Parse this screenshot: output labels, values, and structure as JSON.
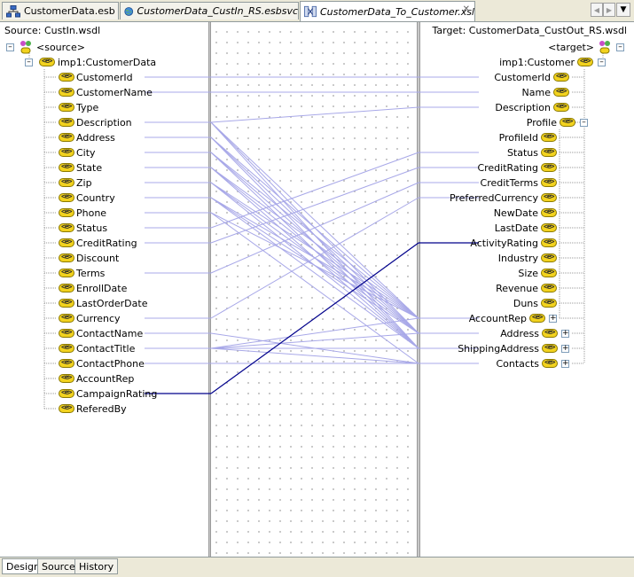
{
  "tabs": [
    {
      "label": "CustomerData.esb",
      "icon": "esb-diagram-icon",
      "italic": false
    },
    {
      "label": "CustomerData_CustIn_RS.esbsvc",
      "icon": "globe-service-icon",
      "italic": true
    },
    {
      "label": "CustomerData_To_Customer.xsl",
      "icon": "xsl-map-icon",
      "italic": true
    }
  ],
  "source": {
    "title": "Source: CustIn.wsdl",
    "root": "<source>",
    "element": "imp1:CustomerData",
    "fields": [
      "CustomerId",
      "CustomerName",
      "Type",
      "Description",
      "Address",
      "City",
      "State",
      "Zip",
      "Country",
      "Phone",
      "Status",
      "CreditRating",
      "Discount",
      "Terms",
      "EnrollDate",
      "LastOrderDate",
      "Currency",
      "ContactName",
      "ContactTitle",
      "ContactPhone",
      "AccountRep",
      "CampaignRating",
      "ReferedBy"
    ]
  },
  "target": {
    "title": "Target: CustomerData_CustOut_RS.wsdl",
    "root": "<target>",
    "element": "imp1:Customer",
    "nodes": [
      "CustomerId",
      "Name",
      "Description",
      "Profile",
      "ProfileId",
      "Status",
      "CreditRating",
      "CreditTerms",
      "PreferredCurrency",
      "NewDate",
      "LastDate",
      "ActivityRating",
      "Industry",
      "Size",
      "Revenue",
      "Duns",
      "AccountRep",
      "Address",
      "ShippingAddress",
      "Contacts"
    ]
  },
  "badge_text": "<e>",
  "bottom_tabs": [
    "Design",
    "Source",
    "History"
  ],
  "colors": {
    "map_line": "#a8a8e8",
    "selected_line": "#00008b"
  }
}
